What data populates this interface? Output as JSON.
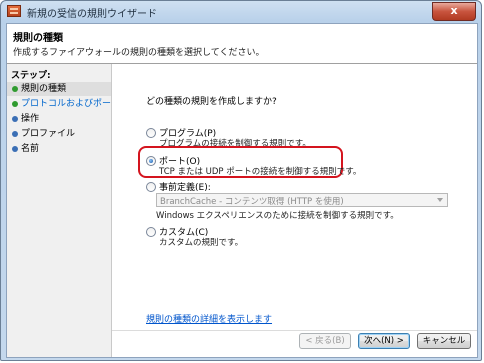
{
  "window": {
    "title": "新規の受信の規則ウイザード",
    "close_glyph": "x"
  },
  "header": {
    "title": "規則の種類",
    "description": "作成するファイアウォールの規則の種類を選択してください。"
  },
  "steps": {
    "title": "ステップ:",
    "items": [
      {
        "label": "規則の種類"
      },
      {
        "label": "プロトコルおよびポート"
      },
      {
        "label": "操作"
      },
      {
        "label": "プロファイル"
      },
      {
        "label": "名前"
      }
    ]
  },
  "main": {
    "question": "どの種類の規則を作成しますか?",
    "options": {
      "program": {
        "label": "プログラム(P)",
        "description": "プログラムの接続を制御する規則です。"
      },
      "port": {
        "label": "ポート(O)",
        "description": "TCP または UDP ポートの接続を制御する規則です。"
      },
      "predefined": {
        "label": "事前定義(E):",
        "dropdown_value": "BranchCache - コンテンツ取得 (HTTP を使用)",
        "description": "Windows エクスペリエンスのために接続を制御する規則です。"
      },
      "custom": {
        "label": "カスタム(C)",
        "description": "カスタムの規則です。"
      }
    },
    "selected_option": "port",
    "learn_more_link": "規則の種類の詳細を表示します"
  },
  "buttons": {
    "back": "< 戻る(B)",
    "next": "次へ(N) >",
    "cancel": "キャンセル"
  }
}
